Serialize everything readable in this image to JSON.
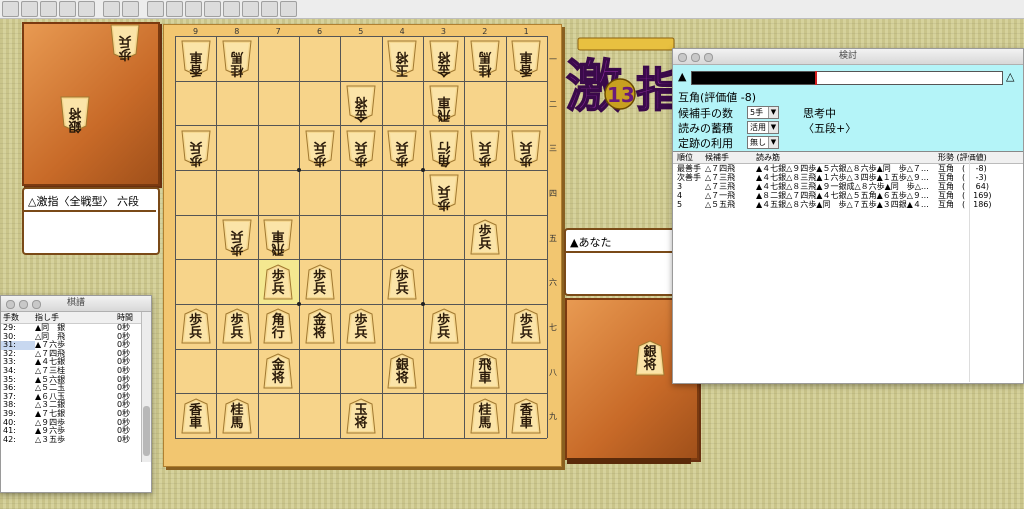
{
  "toolbar": {
    "buttons": [
      "new",
      "open",
      "save",
      "save-as",
      "print",
      "settings",
      "info",
      "go-start",
      "back",
      "stop",
      "forward",
      "go-end",
      "play",
      "window",
      "help"
    ]
  },
  "board": {
    "files": [
      "9",
      "8",
      "7",
      "6",
      "5",
      "4",
      "3",
      "2",
      "1"
    ],
    "ranks": [
      "一",
      "二",
      "三",
      "四",
      "五",
      "六",
      "七",
      "八",
      "九"
    ]
  },
  "pieces": [
    {
      "label": "香\n車",
      "side": "gote",
      "file": 9,
      "rank": 1
    },
    {
      "label": "桂\n馬",
      "side": "gote",
      "file": 8,
      "rank": 1
    },
    {
      "label": "玉\n将",
      "side": "gote",
      "file": 4,
      "rank": 1
    },
    {
      "label": "金\n将",
      "side": "gote",
      "file": 3,
      "rank": 1
    },
    {
      "label": "桂\n馬",
      "side": "gote",
      "file": 2,
      "rank": 1
    },
    {
      "label": "香\n車",
      "side": "gote",
      "file": 1,
      "rank": 1
    },
    {
      "label": "金\n将",
      "side": "gote",
      "file": 5,
      "rank": 2
    },
    {
      "label": "飛\n車",
      "side": "gote",
      "file": 3,
      "rank": 2
    },
    {
      "label": "歩\n兵",
      "side": "gote",
      "file": 9,
      "rank": 3
    },
    {
      "label": "歩\n兵",
      "side": "gote",
      "file": 6,
      "rank": 3
    },
    {
      "label": "歩\n兵",
      "side": "gote",
      "file": 5,
      "rank": 3
    },
    {
      "label": "歩\n兵",
      "side": "gote",
      "file": 4,
      "rank": 3
    },
    {
      "label": "角\n行",
      "side": "gote",
      "file": 3,
      "rank": 3
    },
    {
      "label": "歩\n兵",
      "side": "gote",
      "file": 2,
      "rank": 3
    },
    {
      "label": "歩\n兵",
      "side": "gote",
      "file": 1,
      "rank": 3
    },
    {
      "label": "歩\n兵",
      "side": "gote",
      "file": 3,
      "rank": 4
    },
    {
      "label": "歩\n兵",
      "side": "gote",
      "file": 8,
      "rank": 5
    },
    {
      "label": "飛\n車",
      "side": "gote",
      "file": 7,
      "rank": 5
    },
    {
      "label": "歩\n兵",
      "side": "sente",
      "file": 2,
      "rank": 5
    },
    {
      "label": "歩\n兵",
      "side": "sente",
      "file": 7,
      "rank": 6
    },
    {
      "label": "歩\n兵",
      "side": "sente",
      "file": 6,
      "rank": 6
    },
    {
      "label": "歩\n兵",
      "side": "sente",
      "file": 4,
      "rank": 6
    },
    {
      "label": "歩\n兵",
      "side": "sente",
      "file": 9,
      "rank": 7
    },
    {
      "label": "歩\n兵",
      "side": "sente",
      "file": 8,
      "rank": 7
    },
    {
      "label": "角\n行",
      "side": "sente",
      "file": 7,
      "rank": 7
    },
    {
      "label": "金\n将",
      "side": "sente",
      "file": 6,
      "rank": 7
    },
    {
      "label": "歩\n兵",
      "side": "sente",
      "file": 5,
      "rank": 7
    },
    {
      "label": "歩\n兵",
      "side": "sente",
      "file": 3,
      "rank": 7
    },
    {
      "label": "歩\n兵",
      "side": "sente",
      "file": 1,
      "rank": 7
    },
    {
      "label": "金\n将",
      "side": "sente",
      "file": 7,
      "rank": 8
    },
    {
      "label": "銀\n将",
      "side": "sente",
      "file": 4,
      "rank": 8
    },
    {
      "label": "飛\n車",
      "side": "sente",
      "file": 2,
      "rank": 8
    },
    {
      "label": "香\n車",
      "side": "sente",
      "file": 9,
      "rank": 9
    },
    {
      "label": "桂\n馬",
      "side": "sente",
      "file": 8,
      "rank": 9
    },
    {
      "label": "玉\n将",
      "side": "sente",
      "file": 5,
      "rank": 9
    },
    {
      "label": "桂\n馬",
      "side": "sente",
      "file": 2,
      "rank": 9
    },
    {
      "label": "香\n車",
      "side": "sente",
      "file": 1,
      "rank": 9
    }
  ],
  "highlight": [
    {
      "file": 7,
      "rank": 6
    }
  ],
  "gote_hand": [
    {
      "label": "歩\n兵"
    },
    {
      "label": "銀\n将"
    }
  ],
  "sente_hand": [
    {
      "label": "銀\n将"
    }
  ],
  "gote_player": "△激指〈全戦型〉 六段",
  "sente_player": "▲あなた",
  "record_window": {
    "title": "棋譜",
    "headers": [
      "手数",
      "指し手",
      "時間"
    ],
    "rows": [
      {
        "n": "29:",
        "move": "▲同　銀",
        "time": "0秒"
      },
      {
        "n": "30:",
        "move": "△同　飛",
        "time": "0秒"
      },
      {
        "n": "31:",
        "move": "▲７六歩",
        "time": "0秒"
      },
      {
        "n": "32:",
        "move": "△７四飛",
        "time": "0秒"
      },
      {
        "n": "33:",
        "move": "▲４七銀",
        "time": "0秒"
      },
      {
        "n": "34:",
        "move": "△７三桂",
        "time": "0秒"
      },
      {
        "n": "35:",
        "move": "▲５六銀",
        "time": "0秒"
      },
      {
        "n": "36:",
        "move": "△５二玉",
        "time": "0秒"
      },
      {
        "n": "37:",
        "move": "▲６八玉",
        "time": "0秒"
      },
      {
        "n": "38:",
        "move": "△３二銀",
        "time": "0秒"
      },
      {
        "n": "39:",
        "move": "▲７七銀",
        "time": "0秒"
      },
      {
        "n": "40:",
        "move": "△９四歩",
        "time": "0秒"
      },
      {
        "n": "41:",
        "move": "▲９六歩",
        "time": "0秒"
      },
      {
        "n": "42:",
        "move": "△３五歩",
        "time": "0秒"
      }
    ]
  },
  "analysis_window": {
    "title": "検討",
    "sente_mark": "▲",
    "gote_mark": "△",
    "evaluation_fraction": 0.4,
    "eval_text": "互角(評価値 -8)",
    "candidates_label": "候補手の数",
    "candidates_value": "5手",
    "thinking_label": "思考中",
    "reading_label": "読みの蓄積",
    "reading_value": "活用",
    "level_label": "〈五段+〉",
    "joseki_label": "定跡の利用",
    "joseki_value": "無し",
    "headers": [
      "順位",
      "候補手",
      "読み筋",
      "形勢 (評価値)"
    ],
    "rows": [
      {
        "rank": "最善手",
        "move": "△７四飛",
        "line": "▲４七銀△９四歩▲５六銀△８六歩▲同　歩△７…",
        "eval": "互角",
        "score": "(　 -8)"
      },
      {
        "rank": "次善手",
        "move": "△７三飛",
        "line": "▲４七銀△８三飛▲１六歩△３四歩▲１五歩△９…",
        "eval": "互角",
        "score": "(　 -3)"
      },
      {
        "rank": "3",
        "move": "△７三飛",
        "line": "▲４七銀△８三飛▲９一銀成△８六歩▲同　歩△…",
        "eval": "互角",
        "score": "(　 64)"
      },
      {
        "rank": "4",
        "move": "△７一飛",
        "line": "▲８二銀△７四飛▲４七銀△５五角▲６五歩△９…",
        "eval": "互角",
        "score": "(　169)"
      },
      {
        "rank": "5",
        "move": "△５五飛",
        "line": "▲４五銀△８六歩▲同　歩△７五歩▲３四銀▲４…",
        "eval": "互角",
        "score": "(　186)"
      }
    ]
  },
  "colors": {
    "board": "#f7d48a",
    "komadai": "#d87a38",
    "analysis_bg": "#b4f4f8",
    "eval_bar": "#000000",
    "eval_marker": "#d02020"
  }
}
